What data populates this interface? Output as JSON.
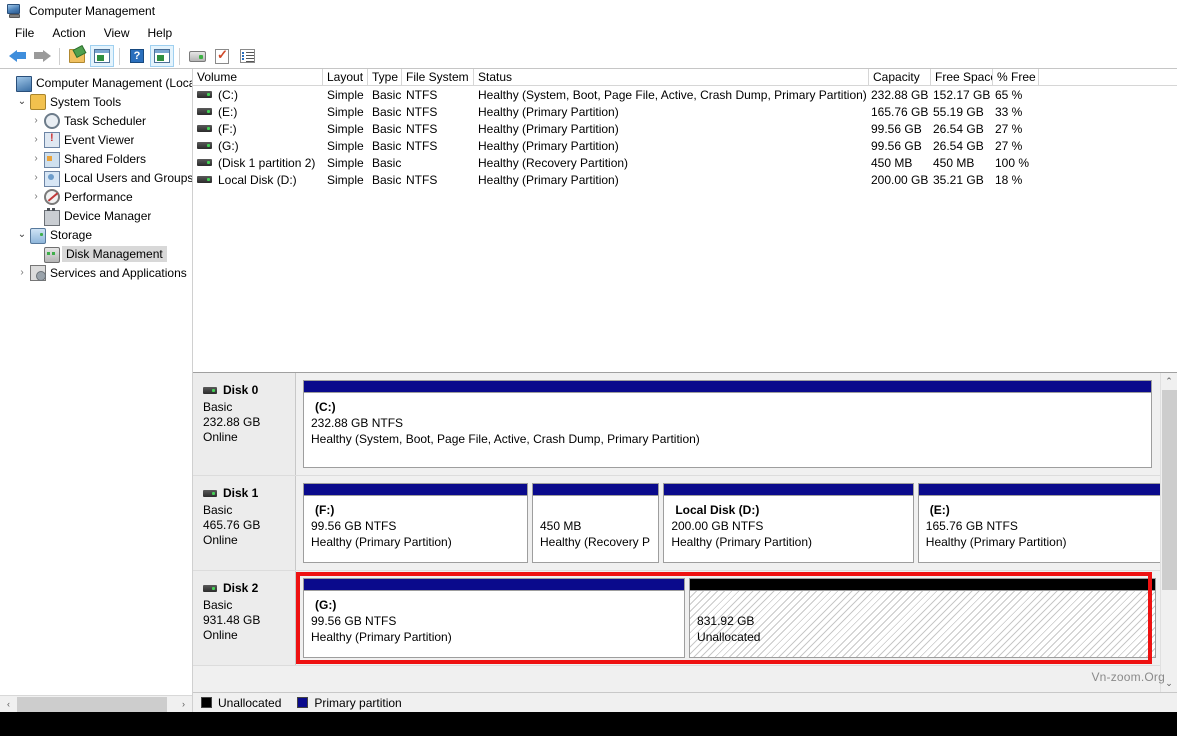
{
  "window": {
    "title": "Computer Management",
    "icon": "computer-management-icon"
  },
  "menu": {
    "items": [
      "File",
      "Action",
      "View",
      "Help"
    ]
  },
  "toolbar": {
    "buttons": [
      {
        "name": "back-arrow-icon",
        "glyph": "←"
      },
      {
        "name": "forward-arrow-icon",
        "glyph": "→"
      },
      {
        "name": "up-folder-icon",
        "glyph": "folder"
      },
      {
        "name": "show-console-tree-icon",
        "glyph": "window"
      },
      {
        "name": "help-icon",
        "glyph": "?"
      },
      {
        "name": "show-action-pane-icon",
        "glyph": "window-play"
      },
      {
        "name": "rescan-disks-icon",
        "glyph": "disk"
      },
      {
        "name": "properties-icon",
        "glyph": "check-doc"
      },
      {
        "name": "list-view-icon",
        "glyph": "list"
      }
    ]
  },
  "sidebar": {
    "items": [
      {
        "label": "Computer Management (Local",
        "icon": "computer-icon",
        "indent": 0,
        "chevron": "",
        "selected": false
      },
      {
        "label": "System Tools",
        "icon": "tools-icon",
        "indent": 1,
        "chevron": "open",
        "selected": false
      },
      {
        "label": "Task Scheduler",
        "icon": "clock-icon",
        "indent": 2,
        "chevron": "closed",
        "selected": false
      },
      {
        "label": "Event Viewer",
        "icon": "event-log-icon",
        "indent": 2,
        "chevron": "closed",
        "selected": false
      },
      {
        "label": "Shared Folders",
        "icon": "shared-folders-icon",
        "indent": 2,
        "chevron": "closed",
        "selected": false
      },
      {
        "label": "Local Users and Groups",
        "icon": "users-icon",
        "indent": 2,
        "chevron": "closed",
        "selected": false
      },
      {
        "label": "Performance",
        "icon": "performance-icon",
        "indent": 2,
        "chevron": "closed",
        "selected": false
      },
      {
        "label": "Device Manager",
        "icon": "device-manager-icon",
        "indent": 2,
        "chevron": "",
        "selected": false
      },
      {
        "label": "Storage",
        "icon": "storage-icon",
        "indent": 1,
        "chevron": "open",
        "selected": false
      },
      {
        "label": "Disk Management",
        "icon": "disk-management-icon",
        "indent": 2,
        "chevron": "",
        "selected": true
      },
      {
        "label": "Services and Applications",
        "icon": "services-icon",
        "indent": 1,
        "chevron": "closed",
        "selected": false
      }
    ]
  },
  "volume_list": {
    "columns": [
      "Volume",
      "Layout",
      "Type",
      "File System",
      "Status",
      "Capacity",
      "Free Space",
      "% Free"
    ],
    "rows": [
      {
        "volume": "(C:)",
        "layout": "Simple",
        "type": "Basic",
        "fs": "NTFS",
        "status": "Healthy (System, Boot, Page File, Active, Crash Dump, Primary Partition)",
        "capacity": "232.88 GB",
        "free": "152.17 GB",
        "pfree": "65 %"
      },
      {
        "volume": "(E:)",
        "layout": "Simple",
        "type": "Basic",
        "fs": "NTFS",
        "status": "Healthy (Primary Partition)",
        "capacity": "165.76 GB",
        "free": "55.19 GB",
        "pfree": "33 %"
      },
      {
        "volume": "(F:)",
        "layout": "Simple",
        "type": "Basic",
        "fs": "NTFS",
        "status": "Healthy (Primary Partition)",
        "capacity": "99.56 GB",
        "free": "26.54 GB",
        "pfree": "27 %"
      },
      {
        "volume": "(G:)",
        "layout": "Simple",
        "type": "Basic",
        "fs": "NTFS",
        "status": "Healthy (Primary Partition)",
        "capacity": "99.56 GB",
        "free": "26.54 GB",
        "pfree": "27 %"
      },
      {
        "volume": "(Disk 1 partition 2)",
        "layout": "Simple",
        "type": "Basic",
        "fs": "",
        "status": "Healthy (Recovery Partition)",
        "capacity": "450 MB",
        "free": "450 MB",
        "pfree": "100 %"
      },
      {
        "volume": "Local Disk  (D:)",
        "layout": "Simple",
        "type": "Basic",
        "fs": "NTFS",
        "status": "Healthy (Primary Partition)",
        "capacity": "200.00 GB",
        "free": "35.21 GB",
        "pfree": "18 %"
      }
    ]
  },
  "disks": [
    {
      "name": "Disk 0",
      "type": "Basic",
      "size": "232.88 GB",
      "state": "Online",
      "partitions": [
        {
          "name": "(C:)",
          "size_line": "232.88 GB NTFS",
          "status_line": "Healthy (System, Boot, Page File, Active, Crash Dump, Primary Partition)",
          "kind": "primary",
          "width_pct": 100
        }
      ]
    },
    {
      "name": "Disk 1",
      "type": "Basic",
      "size": "465.76 GB",
      "state": "Online",
      "partitions": [
        {
          "name": "(F:)",
          "size_line": "99.56 GB NTFS",
          "status_line": "Healthy (Primary Partition)",
          "kind": "primary",
          "width_pct": 26.5
        },
        {
          "name": "",
          "size_line": "450 MB",
          "status_line": "Healthy (Recovery P",
          "kind": "primary",
          "width_pct": 15.0
        },
        {
          "name": "Local Disk   (D:)",
          "size_line": "200.00 GB NTFS",
          "status_line": "Healthy (Primary Partition)",
          "kind": "primary",
          "width_pct": 29.5
        },
        {
          "name": "(E:)",
          "size_line": "165.76 GB NTFS",
          "status_line": "Healthy (Primary Partition)",
          "kind": "primary",
          "width_pct": 29.0
        }
      ]
    },
    {
      "name": "Disk 2",
      "type": "Basic",
      "size": "931.48 GB",
      "state": "Online",
      "highlighted": true,
      "partitions": [
        {
          "name": "(G:)",
          "size_line": "99.56 GB NTFS",
          "status_line": "Healthy (Primary Partition)",
          "kind": "primary",
          "width_pct": 45.0
        },
        {
          "name": "",
          "size_line": "831.92 GB",
          "status_line": "Unallocated",
          "kind": "unallocated",
          "width_pct": 55.0
        }
      ]
    }
  ],
  "legend": {
    "entries": [
      {
        "label": "Unallocated",
        "color": "#000000"
      },
      {
        "label": "Primary partition",
        "color": "#0a0a8c"
      }
    ]
  },
  "watermark": "Vn-zoom.Org",
  "colors": {
    "primary_partition": "#0a0a8c",
    "unallocated": "#000000",
    "highlight_box": "#ee1111",
    "window_bg": "#f0f0f0",
    "selection": "#d8d8d8"
  },
  "scrollbars": {
    "tree_h_left": "‹",
    "tree_h_right": "›",
    "graph_v_up": "⌃",
    "graph_v_down": "⌄"
  }
}
